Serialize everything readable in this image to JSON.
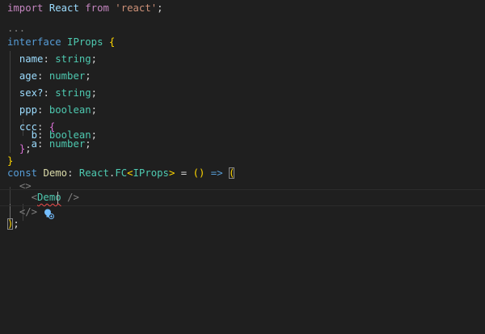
{
  "editor": {
    "language": "typescript",
    "lines": [
      {
        "text": "import React from 'react';"
      },
      {
        "text": ""
      },
      {
        "text": "..."
      },
      {
        "text": "interface IProps {"
      },
      {
        "text": "  name: string;"
      },
      {
        "text": "  age: number;"
      },
      {
        "text": "  sex?: string;"
      },
      {
        "text": "  ppp: boolean;"
      },
      {
        "text": "  ccc: {"
      },
      {
        "text": "    a: number;"
      },
      {
        "text": "    b: boolean;"
      },
      {
        "text": "  };"
      },
      {
        "text": "}"
      },
      {
        "text": "const Demo: React.FC<IProps> = () => ("
      },
      {
        "text": "  <>"
      },
      {
        "text": "    <Demo />"
      },
      {
        "text": "  </>"
      },
      {
        "text": ");"
      }
    ],
    "tokens": {
      "import": "import",
      "react_ident": "React",
      "from": "from",
      "react_str": "'react'",
      "semicolon": ";",
      "ellipsis": "...",
      "interface": "interface",
      "iprops": "IProps",
      "open_brace": "{",
      "close_brace": "}",
      "name": "name",
      "age": "age",
      "sex": "sex?",
      "ppp": "ppp",
      "ccc": "ccc",
      "a": "a",
      "b": "b",
      "string": "string",
      "number": "number",
      "boolean": "boolean",
      "colon": ":",
      "close_inner": "};",
      "const": "const",
      "demo": "Demo",
      "react_fc_obj": "React",
      "dot": ".",
      "fc": "FC",
      "lt": "<",
      "gt": ">",
      "eq": "=",
      "parens": "()",
      "arrow": "=>",
      "open_paren": "(",
      "fragment_open": "<>",
      "tag_open": "<",
      "demo_tag": "Demo",
      "self_close": "/>",
      "fragment_close": "</>",
      "close_paren": ")",
      "final_semicolon": ";"
    },
    "code_action_icon": "lightbulb-icon"
  }
}
